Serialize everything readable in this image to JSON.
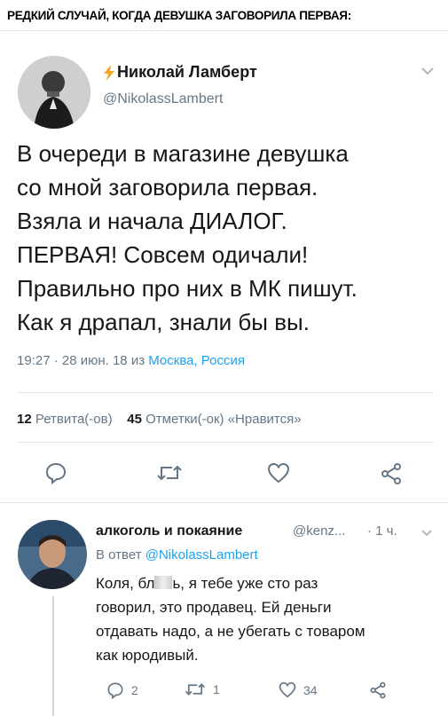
{
  "header": {
    "title": "РЕДКИЙ СЛУЧАЙ, КОГДА ДЕВУШКА ЗАГОВОРИЛА ПЕРВАЯ:"
  },
  "tweet": {
    "display_name": "Николай Ламберт",
    "handle": "@NikolassLambert",
    "text_lines": [
      "В очереди в магазине девушка",
      "со мной заговорила первая.",
      "Взяла и начала ДИАЛОГ.",
      "ПЕРВАЯ! Совсем одичали!",
      "Правильно про них в МК пишут.",
      "Как я драпал, знали бы вы."
    ],
    "timestamp": "19:27 · 28 июн. 18 из",
    "location": "Москва, Россия",
    "retweets_count": "12",
    "retweets_label": "Ретвита(-ов)",
    "likes_count": "45",
    "likes_label": "Отметки(-ок) «Нравится»"
  },
  "reply": {
    "display_name": "алкоголь и покаяние",
    "handle": "@kenz...",
    "time": "· 1 ч.",
    "reply_to_prefix": "В ответ",
    "reply_to_handle": "@NikolassLambert",
    "line1_start": "Коля, бл",
    "line1_end": "ь, я тебе уже сто раз",
    "line2": "говорил, это продавец. Ей деньги",
    "line3": "отдавать надо, а не убегать с товаром",
    "line4": "как юродивый.",
    "reply_count": "2",
    "retweet_count": "1",
    "like_count": "34"
  },
  "icons": {
    "bolt": "lightning-bolt-icon",
    "chevron": "chevron-down-icon",
    "reply": "reply-icon",
    "retweet": "retweet-icon",
    "like": "heart-icon",
    "share": "share-icon"
  },
  "colors": {
    "link": "#1da1f2",
    "muted": "#657786",
    "text": "#14171a",
    "bolt": "#f5a623"
  }
}
